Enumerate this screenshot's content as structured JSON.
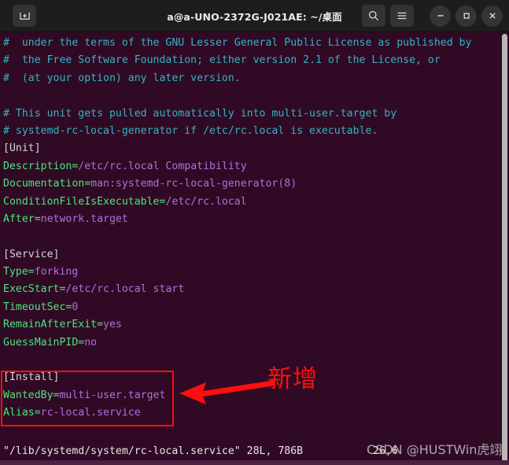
{
  "window": {
    "title": "a@a-UNO-2372G-J021AE: ~/桌面"
  },
  "titlebar": {
    "new_tab_label": "+",
    "search_label": "⌕",
    "menu_label": "≡",
    "minimize_label": "–",
    "maximize_label": "□",
    "close_label": "✕",
    "icons": {
      "new_tab": "new-tab-icon",
      "search": "search-icon",
      "menu": "hamburger-menu-icon",
      "minimize": "minimize-icon",
      "maximize": "maximize-icon",
      "close": "close-icon"
    }
  },
  "editor": {
    "lines": [
      {
        "segments": [
          {
            "text": "#  under the terms of the GNU Lesser General Public License as published by",
            "style": "cmt"
          }
        ]
      },
      {
        "segments": [
          {
            "text": "#  the Free Software Foundation; either version 2.1 of the License, or",
            "style": "cmt"
          }
        ]
      },
      {
        "segments": [
          {
            "text": "#  (at your option) any later version.",
            "style": "cmt"
          }
        ]
      },
      {
        "segments": [
          {
            "text": "",
            "style": "cmt"
          }
        ]
      },
      {
        "segments": [
          {
            "text": "# This unit gets pulled automatically into multi-user.target by",
            "style": "cmt"
          }
        ]
      },
      {
        "segments": [
          {
            "text": "# systemd-rc-local-generator if /etc/rc.local is executable.",
            "style": "cmt"
          }
        ]
      },
      {
        "segments": [
          {
            "text": "[Unit]",
            "style": "sect"
          }
        ]
      },
      {
        "segments": [
          {
            "text": "Description=",
            "style": "key"
          },
          {
            "text": "/etc/rc.local Compatibility",
            "style": "val"
          }
        ]
      },
      {
        "segments": [
          {
            "text": "Documentation=",
            "style": "key"
          },
          {
            "text": "man:systemd-rc-local-generator(8)",
            "style": "val"
          }
        ]
      },
      {
        "segments": [
          {
            "text": "ConditionFileIsExecutable=",
            "style": "key"
          },
          {
            "text": "/etc/rc.local",
            "style": "val"
          }
        ]
      },
      {
        "segments": [
          {
            "text": "After=",
            "style": "key"
          },
          {
            "text": "network.target",
            "style": "val"
          }
        ]
      },
      {
        "segments": [
          {
            "text": "",
            "style": "cmt"
          }
        ]
      },
      {
        "segments": [
          {
            "text": "[Service]",
            "style": "sect"
          }
        ]
      },
      {
        "segments": [
          {
            "text": "Type=",
            "style": "key"
          },
          {
            "text": "forking",
            "style": "val"
          }
        ]
      },
      {
        "segments": [
          {
            "text": "ExecStart=",
            "style": "key"
          },
          {
            "text": "/etc/rc.local start",
            "style": "val"
          }
        ]
      },
      {
        "segments": [
          {
            "text": "TimeoutSec=",
            "style": "key"
          },
          {
            "text": "0",
            "style": "val"
          }
        ]
      },
      {
        "segments": [
          {
            "text": "RemainAfterExit=",
            "style": "key"
          },
          {
            "text": "yes",
            "style": "val"
          }
        ]
      },
      {
        "segments": [
          {
            "text": "GuessMainPID=",
            "style": "key"
          },
          {
            "text": "no",
            "style": "val"
          }
        ]
      },
      {
        "segments": [
          {
            "text": "",
            "style": "cmt"
          }
        ]
      },
      {
        "segments": [
          {
            "text": "[Install]",
            "style": "sect"
          }
        ]
      },
      {
        "segments": [
          {
            "text": "WantedBy=",
            "style": "key"
          },
          {
            "text": "multi-user.target",
            "style": "val"
          }
        ]
      },
      {
        "segments": [
          {
            "text": "Alias=",
            "style": "key"
          },
          {
            "text": "rc-local.service",
            "style": "val"
          }
        ]
      }
    ],
    "statusline": "\"/lib/systemd/system/rc-local.service\" 28L, 786B",
    "ruler": "26,6"
  },
  "annotations": {
    "label": "新增",
    "box_color": "#fb0f10",
    "arrow_color": "#fb0f10"
  },
  "watermark": {
    "text": "CSDN @HUSTWin虎翊"
  },
  "colors": {
    "terminal_background": "#300a24",
    "titlebar_background": "#1e1c1d",
    "comment": "#34b3c4",
    "key": "#4ee37f",
    "value": "#b06fdd",
    "section": "#d8d3d6"
  }
}
